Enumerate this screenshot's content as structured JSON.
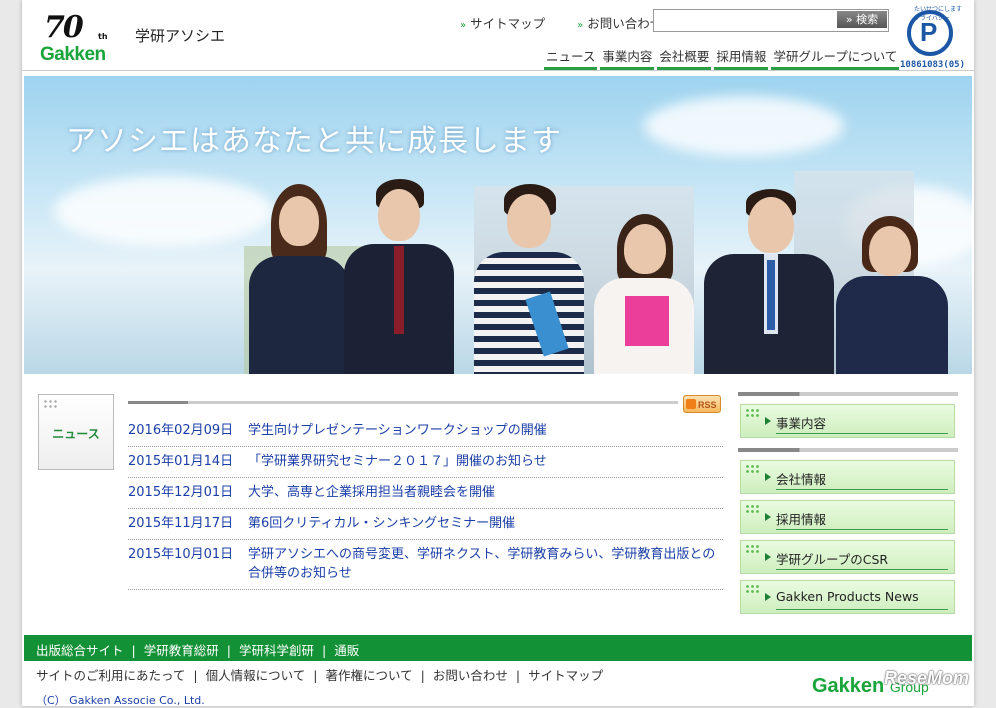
{
  "logo": {
    "anniv": "70",
    "anniv_suffix": "th",
    "word": "Gakken"
  },
  "company_name": "学研アソシエ",
  "top_links": [
    "サイトマップ",
    "お問い合わせ"
  ],
  "search": {
    "placeholder": "",
    "button": "検索"
  },
  "global_nav": [
    "ニュース",
    "事業内容",
    "会社概要",
    "採用情報",
    "学研グループについて"
  ],
  "privacy_mark": {
    "arc": "たいせつにしますプライバシー",
    "letter": "P",
    "code": "10861083(05)"
  },
  "hero": {
    "catch": "アソシエはあなたと共に成長します"
  },
  "news": {
    "label": "ニュース",
    "rss": "RSS",
    "items": [
      {
        "date": "2016年02月09日",
        "title": "学生向けプレゼンテーションワークショップの開催"
      },
      {
        "date": "2015年01月14日",
        "title": "「学研業界研究セミナー２０１７」開催のお知らせ"
      },
      {
        "date": "2015年12月01日",
        "title": "大学、高専と企業採用担当者親睦会を開催"
      },
      {
        "date": "2015年11月17日",
        "title": "第6回クリティカル・シンキングセミナー開催"
      },
      {
        "date": "2015年10月01日",
        "title": "学研アソシエへの商号変更、学研ネクスト、学研教育みらい、学研教育出版との合併等のお知らせ"
      }
    ]
  },
  "side_menu": [
    "事業内容",
    "会社情報",
    "採用情報",
    "学研グループのCSR",
    "Gakken Products News"
  ],
  "footer": {
    "green_links": [
      "出版総合サイト",
      "学研教育総研",
      "学研科学創研",
      "通販"
    ],
    "sub_links": [
      "サイトのご利用にあたって",
      "個人情報について",
      "著作権について",
      "お問い合わせ",
      "サイトマップ"
    ],
    "copyright": "（C） Gakken Associe Co., Ltd.",
    "group_logo": "Gakken",
    "group_suffix": "Group",
    "watermark": "ReseMom"
  },
  "colors": {
    "brand_green": "#139136",
    "link_blue": "#1b3fa8"
  }
}
